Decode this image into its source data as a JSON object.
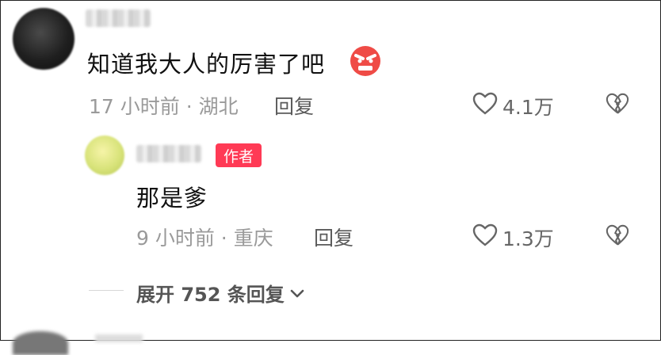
{
  "comment": {
    "text": "知道我大人的厉害了吧",
    "time_location": "17 小时前 · 湖北",
    "reply_label": "回复",
    "likes": "4.1万",
    "emoji": "angry-face-emoji"
  },
  "reply": {
    "author_badge": "作者",
    "text": "那是爹",
    "time_location": "9 小时前 · 重庆",
    "reply_label": "回复",
    "likes": "1.3万"
  },
  "expand": {
    "label": "展开 752 条回复"
  },
  "colors": {
    "badge": "#ff3a55",
    "meta_text": "#9a9a9a"
  }
}
